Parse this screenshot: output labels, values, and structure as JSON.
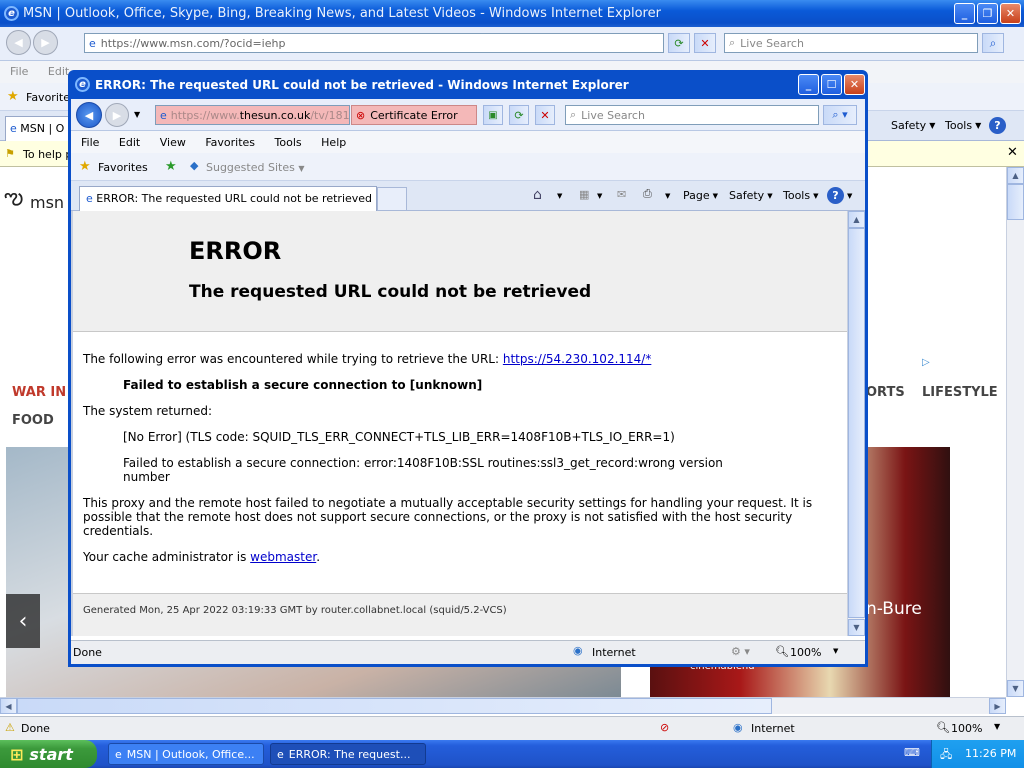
{
  "outer": {
    "title": "MSN | Outlook, Office, Skype, Bing, Breaking News, and Latest Videos - Windows Internet Explorer",
    "address": "https://www.msn.com/?ocid=iehp",
    "search_placeholder": "Live Search",
    "menu": [
      "File",
      "Edit"
    ],
    "favorites_label": "Favorites",
    "tab_label": "MSN | O",
    "info_text": "To help p",
    "logo_text": "msn",
    "nav_left": "WAR IN U",
    "nav_food": "FOOD",
    "nav_right": [
      "ORTS",
      "LIFESTYLE"
    ],
    "card_caption": "n-Bure",
    "card_sub": "cinemablend",
    "toolbar": [
      "Safety",
      "Tools"
    ],
    "status": "Done",
    "zone": "Internet",
    "zoom": "100%"
  },
  "popup": {
    "title": "ERROR: The requested URL could not be retrieved - Windows Internet Explorer",
    "address_prefix": "https://www.",
    "address_host": "thesun.co.uk",
    "address_suffix": "/tv/181",
    "cert_error": "Certificate Error",
    "search_placeholder": "Live Search",
    "menu": [
      "File",
      "Edit",
      "View",
      "Favorites",
      "Tools",
      "Help"
    ],
    "favorites_label": "Favorites",
    "suggested_sites": "Suggested Sites",
    "tab_label": "ERROR: The requested URL could not be retrieved",
    "tools": {
      "page": "Page",
      "safety": "Safety",
      "tools": "Tools"
    },
    "status": "Done",
    "zone": "Internet",
    "zoom": "100%"
  },
  "error_page": {
    "heading": "ERROR",
    "subheading": "The requested URL could not be retrieved",
    "intro": "The following error was encountered while trying to retrieve the URL:",
    "url": "https://54.230.102.114/*",
    "failed": "Failed to establish a secure connection to [unknown]",
    "system_returned": "The system returned:",
    "no_error": "[No Error] (TLS code: SQUID_TLS_ERR_CONNECT+TLS_LIB_ERR=1408F10B+TLS_IO_ERR=1)",
    "ssl_error": "Failed to establish a secure connection: error:1408F10B:SSL routines:ssl3_get_record:wrong version number",
    "proxy_note": "This proxy and the remote host failed to negotiate a mutually acceptable security settings for handling your request. It is possible that the remote host does not support secure connections, or the proxy is not satisfied with the host security credentials.",
    "admin_prefix": "Your cache administrator is",
    "admin_link": "webmaster",
    "admin_suffix": ".",
    "footer": "Generated Mon, 25 Apr 2022 03:19:33 GMT by router.collabnet.local (squid/5.2-VCS)"
  },
  "taskbar": {
    "start": "start",
    "tasks": [
      "MSN | Outlook, Office...",
      "ERROR: The request..."
    ],
    "clock": "11:26 PM"
  },
  "colors": {
    "xp_blue": "#0a5ad8",
    "taskbar": "#245edb",
    "start": "#3c9a3c",
    "tray": "#1290e8",
    "msn_red": "#c0392b"
  }
}
